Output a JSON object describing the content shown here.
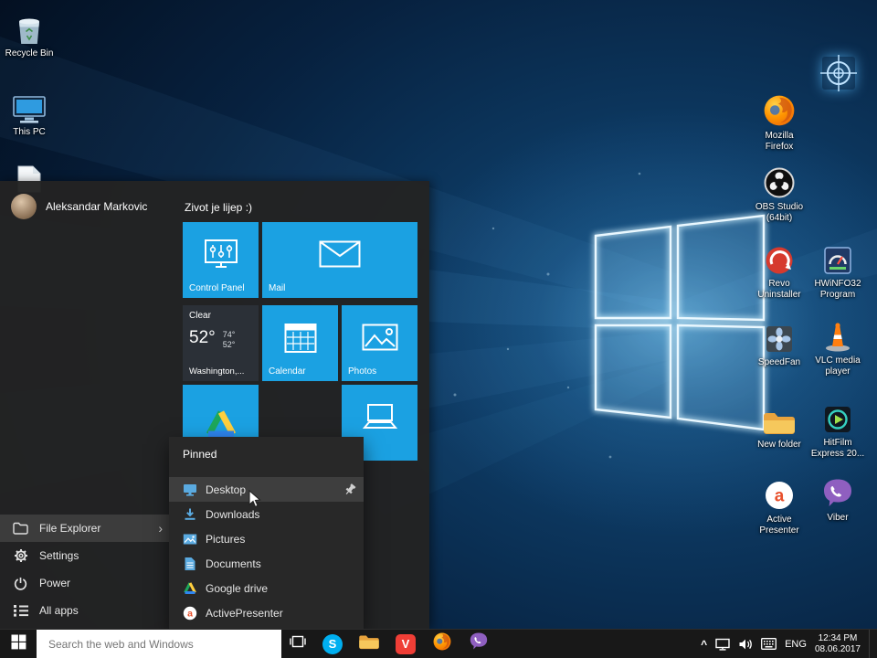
{
  "colors": {
    "tile_accent": "#1ba1e2",
    "taskbar_bg": "#181818",
    "menu_bg": "#232323",
    "highlight": "#3c3c3c"
  },
  "desktop": {
    "icons_left": [
      {
        "icon": "recycle-bin",
        "label": "Recycle Bin"
      },
      {
        "icon": "this-pc",
        "label": "This PC"
      },
      {
        "icon": "document",
        "label": ""
      }
    ],
    "icons_right": [
      {
        "icon": "scope-target",
        "label": ""
      },
      {
        "icon": "firefox",
        "label": "Mozilla Firefox"
      },
      {
        "icon": "obs-studio",
        "label": "OBS Studio (64bit)"
      },
      {
        "icon": "revo-uninstaller",
        "label": "Revo Uninstaller"
      },
      {
        "icon": "hwinfo32",
        "label": "HWiNFO32 Program"
      },
      {
        "icon": "speedfan",
        "label": "SpeedFan"
      },
      {
        "icon": "vlc",
        "label": "VLC media player"
      },
      {
        "icon": "folder",
        "label": "New folder"
      },
      {
        "icon": "hitfilm",
        "label": "HitFilm Express 20..."
      },
      {
        "icon": "active-presenter",
        "label": "Active Presenter"
      },
      {
        "icon": "viber",
        "label": "Viber"
      }
    ]
  },
  "start_menu": {
    "user_name": "Aleksandar Markovic",
    "group_title": "Zivot je lijep :)",
    "tiles": {
      "control_panel": "Control Panel",
      "mail": "Mail",
      "calendar": "Calendar",
      "photos": "Photos",
      "pc": "PC"
    },
    "weather": {
      "condition": "Clear",
      "temp": "52°",
      "high": "74°",
      "low": "52°",
      "location": "Washington,..."
    },
    "sidebar": [
      {
        "icon": "folder",
        "label": "File Explorer"
      },
      {
        "icon": "gear",
        "label": "Settings"
      },
      {
        "icon": "power",
        "label": "Power"
      },
      {
        "icon": "all-apps",
        "label": "All apps"
      }
    ]
  },
  "pinned": {
    "title": "Pinned",
    "items": [
      {
        "icon": "desktop-monitor",
        "label": "Desktop"
      },
      {
        "icon": "download-arrow",
        "label": "Downloads"
      },
      {
        "icon": "pictures",
        "label": "Pictures"
      },
      {
        "icon": "documents",
        "label": "Documents"
      },
      {
        "icon": "google-drive",
        "label": "Google drive"
      },
      {
        "icon": "active-presenter",
        "label": "ActivePresenter"
      }
    ]
  },
  "taskbar": {
    "search_placeholder": "Search the web and Windows",
    "app_icons": [
      "start",
      "task-view",
      "skype",
      "file-explorer",
      "red-v-app",
      "firefox",
      "viber"
    ],
    "tray": {
      "language": "ENG",
      "time": "12:34 PM",
      "date": "08.06.2017"
    }
  }
}
